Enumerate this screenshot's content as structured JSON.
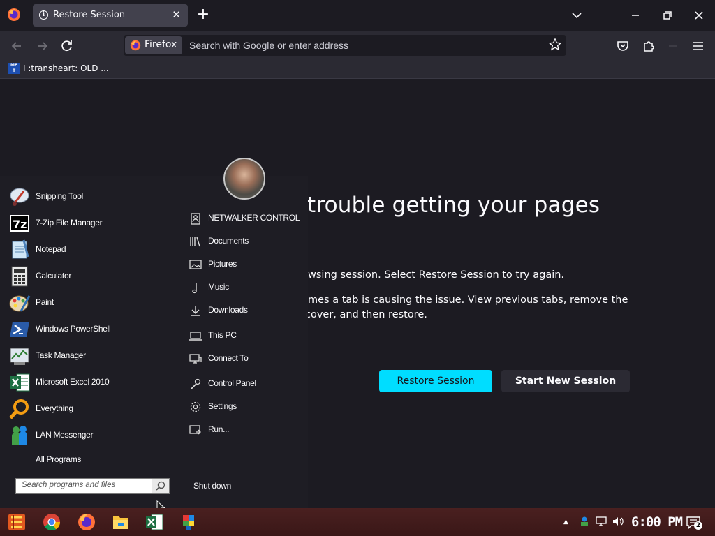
{
  "browser": {
    "tab_title": "Restore Session",
    "tab_close": "✕",
    "new_tab": "+",
    "tab_list": "⌵",
    "window": {
      "minimize": "—",
      "restore": "❐",
      "close": "✕"
    },
    "identity_label": "Firefox",
    "url_placeholder": "Search with Google or enter address",
    "bookmark_favicon_text": "MF T",
    "bookmark_label": "I :transheart: OLD ..."
  },
  "page": {
    "title_fragment": "trouble getting your pages",
    "line1_fragment": "wsing session. Select Restore Session to try again.",
    "line2a_fragment": "mes a tab is causing the issue. View previous tabs, remove the",
    "line2b_fragment": "cover, and then restore.",
    "restore_button": "Restore Session",
    "new_session_button": "Start New Session"
  },
  "start_menu": {
    "programs": [
      {
        "label": "Snipping Tool",
        "icon": "snipping-tool-icon"
      },
      {
        "label": "7-Zip File Manager",
        "icon": "7zip-icon"
      },
      {
        "label": "Notepad",
        "icon": "notepad-icon"
      },
      {
        "label": "Calculator",
        "icon": "calculator-icon"
      },
      {
        "label": "Paint",
        "icon": "paint-icon"
      },
      {
        "label": "Windows PowerShell",
        "icon": "powershell-icon"
      },
      {
        "label": "Task Manager",
        "icon": "task-manager-icon"
      },
      {
        "label": "Microsoft Excel 2010",
        "icon": "excel-icon"
      },
      {
        "label": "Everything",
        "icon": "everything-search-icon"
      },
      {
        "label": "LAN Messenger",
        "icon": "lan-messenger-icon"
      }
    ],
    "all_programs": "All Programs",
    "search_placeholder": "Search programs and files",
    "places": [
      {
        "label": "NETWALKER CONTROL",
        "icon": "user-folder-icon"
      },
      {
        "label": "Documents",
        "icon": "documents-icon"
      },
      {
        "label": "Pictures",
        "icon": "pictures-icon"
      },
      {
        "label": "Music",
        "icon": "music-icon"
      },
      {
        "label": "Downloads",
        "icon": "downloads-icon"
      },
      {
        "label": "This PC",
        "icon": "this-pc-icon"
      },
      {
        "label": "Connect To",
        "icon": "connect-to-icon"
      },
      {
        "label": "Control Panel",
        "icon": "control-panel-icon"
      },
      {
        "label": "Settings",
        "icon": "settings-gear-icon"
      },
      {
        "label": "Run...",
        "icon": "run-icon"
      }
    ],
    "shutdown": "Shut down"
  },
  "taskbar": {
    "pinned": [
      "start-button-icon",
      "chrome-icon",
      "firefox-icon",
      "file-explorer-icon",
      "excel-icon",
      "puzzle-app-icon"
    ],
    "clock": "6:00 PM",
    "notification_count": "2",
    "tray_up_arrow": "▲"
  },
  "colors": {
    "accent": "#00ddff",
    "page_bg": "#1c1b22",
    "toolbar": "#2b2a33",
    "taskbar": "#3a1717"
  }
}
